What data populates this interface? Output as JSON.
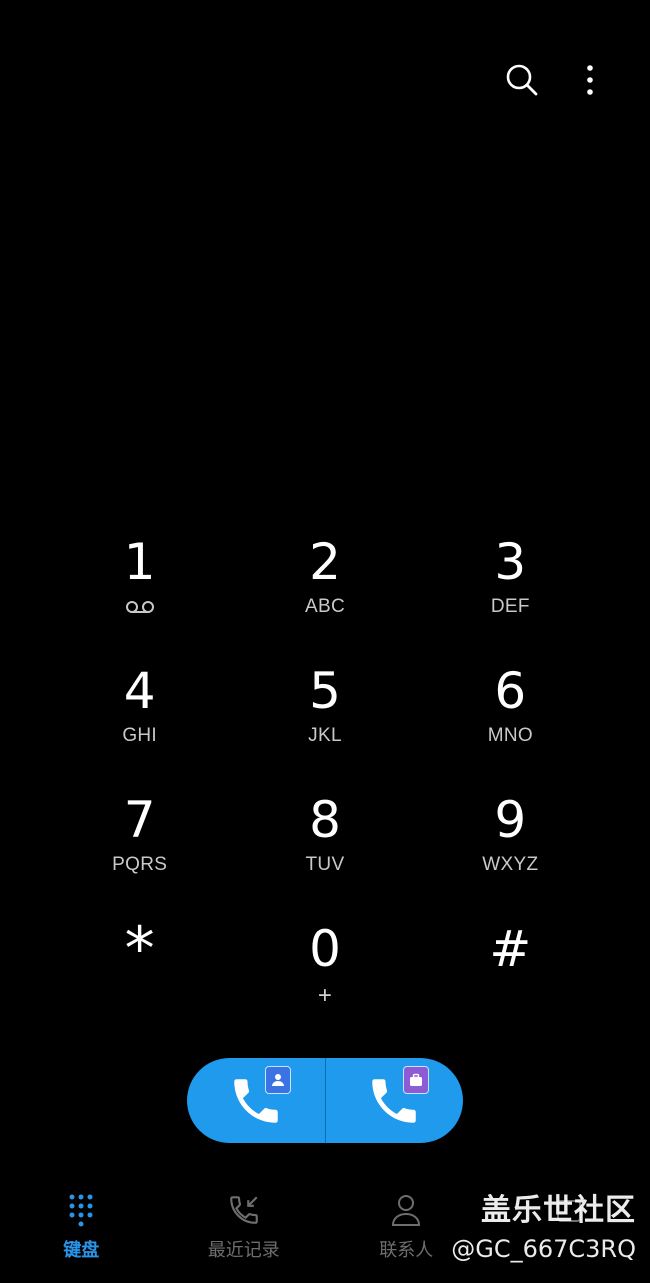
{
  "header": {
    "search_icon": "search-icon",
    "more_icon": "more-vertical-icon"
  },
  "keypad": [
    {
      "digit": "1",
      "sub": "",
      "icon": "voicemail-icon"
    },
    {
      "digit": "2",
      "sub": "ABC"
    },
    {
      "digit": "3",
      "sub": "DEF"
    },
    {
      "digit": "4",
      "sub": "GHI"
    },
    {
      "digit": "5",
      "sub": "JKL"
    },
    {
      "digit": "6",
      "sub": "MNO"
    },
    {
      "digit": "7",
      "sub": "PQRS"
    },
    {
      "digit": "8",
      "sub": "TUV"
    },
    {
      "digit": "9",
      "sub": "WXYZ"
    },
    {
      "digit": "*",
      "sub": ""
    },
    {
      "digit": "0",
      "sub": "+"
    },
    {
      "digit": "#",
      "sub": ""
    }
  ],
  "call_buttons": {
    "personal_icon": "phone-icon",
    "work_icon": "phone-icon",
    "personal_badge": "contact-badge-icon",
    "work_badge": "briefcase-badge-icon",
    "accent_color": "#1f9aec"
  },
  "bottom_nav": {
    "items": [
      {
        "label": "键盘",
        "icon": "dialpad-icon",
        "active": true
      },
      {
        "label": "最近记录",
        "icon": "recent-calls-icon"
      },
      {
        "label": "联系人",
        "icon": "person-icon"
      },
      {
        "label": "",
        "icon": "more-tab-icon"
      }
    ],
    "active_color": "#2a95e8"
  },
  "watermark": {
    "title": "盖乐世社区",
    "user": "@GC_667C3RQ"
  }
}
